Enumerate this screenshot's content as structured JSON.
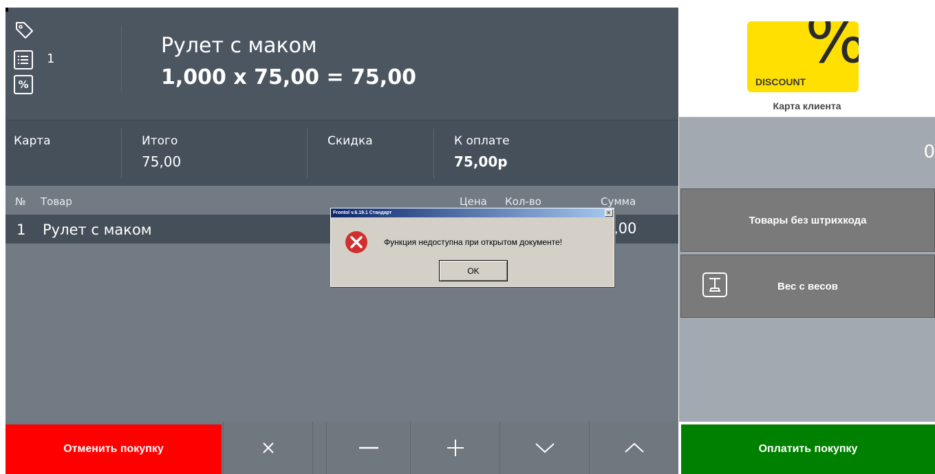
{
  "header": {
    "position_count": "1",
    "product_name": "Рулет с маком",
    "product_calc": "1,000 x 75,00 = 75,00"
  },
  "summary": {
    "card_label": "Карта",
    "total_label": "Итого",
    "total_value": "75,00",
    "discount_label": "Скидка",
    "to_pay_label": "К оплате",
    "to_pay_value": "75,00р"
  },
  "table": {
    "columns": [
      "№",
      "Товар",
      "Цена",
      "Кол-во",
      "Сумма"
    ],
    "rows": [
      {
        "num": "1",
        "name": "Рулет с маком",
        "sum_partial": ",00"
      }
    ]
  },
  "bottom": {
    "cancel_label": "Отменить покупку",
    "buttons": [
      "×",
      "−",
      "+",
      "∨",
      "∧"
    ]
  },
  "right": {
    "discount_text": "DISCOUNT",
    "percent_symbol": "%",
    "client_card_label": "Карта клиента",
    "counter_value": "0",
    "no_barcode_label": "Товары без штрихкода",
    "scale_label": "Вес с весов",
    "pay_label": "Оплатить покупку"
  },
  "dialog": {
    "title": "Frontol v.6.19.1 Стандарт",
    "close": "×",
    "message": "Функция недоступна при открытом документе!",
    "ok_label": "OK"
  },
  "colors": {
    "cancel": "#ff0000",
    "pay": "#008000",
    "discount_card": "#ffe000"
  }
}
